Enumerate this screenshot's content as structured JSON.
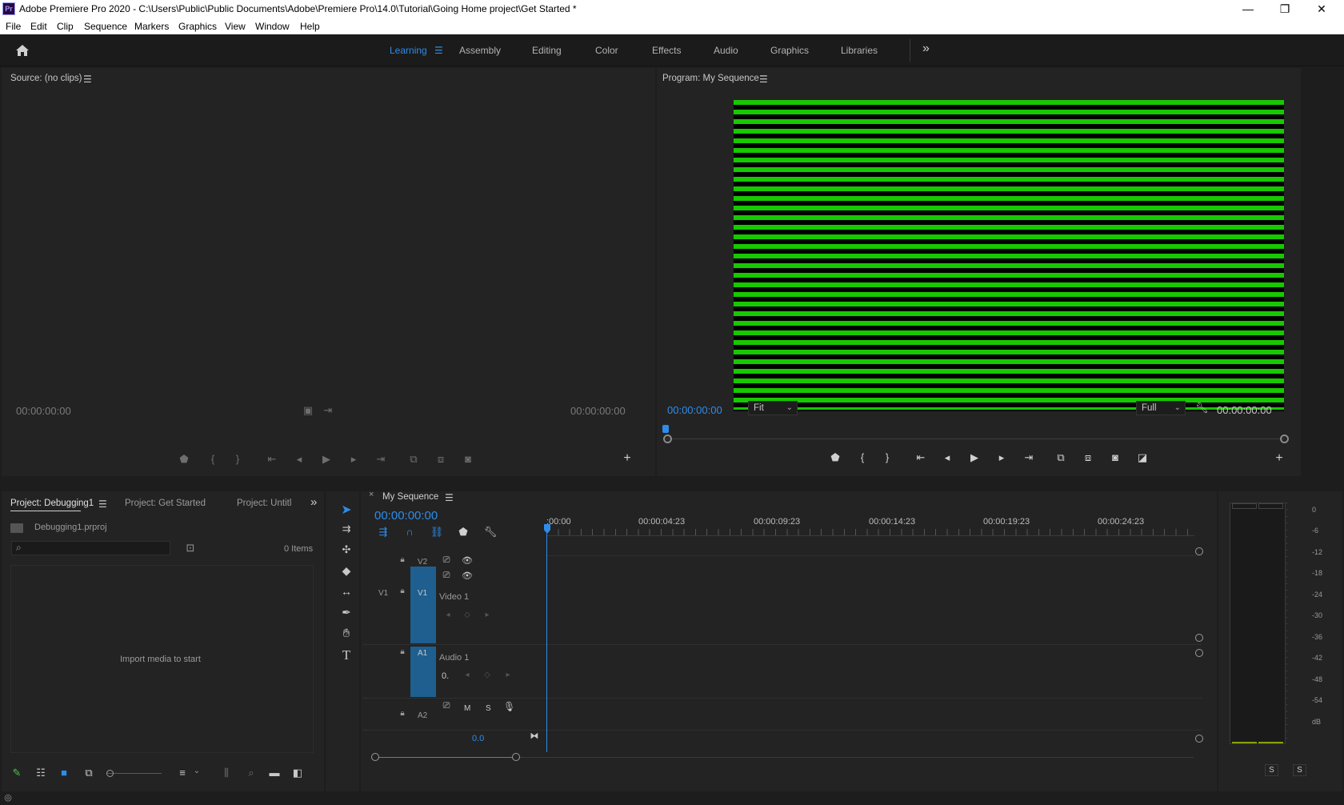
{
  "window": {
    "title": "Adobe Premiere Pro 2020 - C:\\Users\\Public\\Public Documents\\Adobe\\Premiere Pro\\14.0\\Tutorial\\Going Home project\\Get Started *",
    "app_icon": "Pr",
    "minimize": "—",
    "restore": "❐",
    "close": "✕"
  },
  "menu": [
    "File",
    "Edit",
    "Clip",
    "Sequence",
    "Markers",
    "Graphics",
    "View",
    "Window",
    "Help"
  ],
  "workspaces": {
    "items": [
      "Learning",
      "Assembly",
      "Editing",
      "Color",
      "Effects",
      "Audio",
      "Graphics",
      "Libraries"
    ],
    "active": "Learning",
    "overflow": "»"
  },
  "source_monitor": {
    "title": "Source: (no clips)",
    "tc_left": "00:00:00:00",
    "tc_right": "00:00:00:00"
  },
  "program_monitor": {
    "title": "Program: My Sequence",
    "tc_current": "00:00:00:00",
    "zoom": "Fit",
    "quality": "Full",
    "tc_duration": "00:00:00:00",
    "frame_colors": {
      "bar": "#18c800",
      "gap": "#000000"
    }
  },
  "project_panel": {
    "tabs": [
      "Project: Debugging1",
      "Project: Get Started",
      "Project: Untitl"
    ],
    "file": "Debugging1.prproj",
    "items_count": "0 Items",
    "empty_message": "Import media to start",
    "overflow": "»"
  },
  "timeline": {
    "tab": "My Sequence",
    "close": "×",
    "timecode": "00:00:00:00",
    "ruler": [
      ":00:00",
      "00:00:04:23",
      "00:00:09:23",
      "00:00:14:23",
      "00:00:19:23",
      "00:00:24:23"
    ],
    "tracks": {
      "v2": "V2",
      "v1_source": "V1",
      "v1": "V1",
      "video1_name": "Video 1",
      "a1": "A1",
      "audio1_name": "Audio 1",
      "a2": "A2",
      "mute": "M",
      "solo": "S",
      "level": "0.",
      "volume": "0.0"
    }
  },
  "audio_meter": {
    "scale": [
      "0",
      "-6",
      "-12",
      "-18",
      "-24",
      "-30",
      "-36",
      "-42",
      "-48",
      "-54",
      "dB"
    ],
    "solo_left": "S",
    "solo_right": "S"
  },
  "accent_colors": {
    "blue": "#2d8ceb",
    "track_blue": "#1e5f8f"
  }
}
